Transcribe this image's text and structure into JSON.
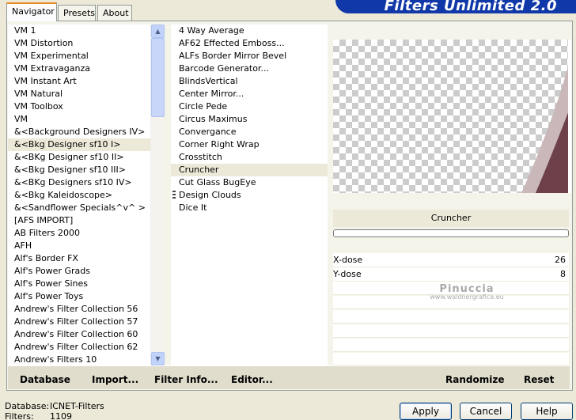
{
  "banner": {
    "title": "Filters Unlimited 2.0"
  },
  "tabs": [
    {
      "label": "Navigator",
      "active": true
    },
    {
      "label": "Presets"
    },
    {
      "label": "About"
    }
  ],
  "categories": [
    "VM 1",
    "VM Distortion",
    "VM Experimental",
    "VM Extravaganza",
    "VM Instant Art",
    "VM Natural",
    "VM Toolbox",
    "VM",
    "&<Background Designers IV>",
    "&<Bkg Designer sf10 I>",
    "&<BKg Designer sf10 II>",
    "&<Bkg Designer sf10 III>",
    "&<BKg Designers sf10 IV>",
    "&<Bkg Kaleidoscope>",
    "&<Sandflower Specials^v^ >",
    "[AFS IMPORT]",
    "AB Filters 2000",
    "AFH",
    "Alf's Border FX",
    "Alf's Power Grads",
    "Alf's Power Sines",
    "Alf's Power Toys",
    "Andrew's Filter Collection 56",
    "Andrew's Filter Collection 57",
    "Andrew's Filter Collection 60",
    "Andrew's Filter Collection 62",
    "Andrew's Filters 10"
  ],
  "selected_category_index": 9,
  "filters": [
    "4 Way Average",
    "AF62 Effected Emboss...",
    "ALFs Border Mirror Bevel",
    "Barcode Generator...",
    "BlindsVertical",
    "Center Mirror...",
    "Circle Pede",
    "Circus Maximus",
    "Convergance",
    "Corner Right Wrap",
    "Crosstitch",
    "Cruncher",
    "Cut Glass  BugEye",
    "Design Clouds",
    "Dice It"
  ],
  "selected_filter_index": 11,
  "preview": {
    "filter_name": "Cruncher",
    "accent_color": "#6e4049",
    "light_accent": "#c9b7b9"
  },
  "sliders": [
    {
      "label": "X-dose",
      "value": "26"
    },
    {
      "label": "Y-dose",
      "value": "8"
    }
  ],
  "watermark": {
    "name": "Pinuccia",
    "url": "www.waldnergrafica.eu"
  },
  "action_bar": {
    "database": "Database",
    "import": "Import...",
    "filter_info": "Filter Info...",
    "editor": "Editor...",
    "randomize": "Randomize",
    "reset": "Reset"
  },
  "info": {
    "database_label": "Database:",
    "database_value": "ICNET-Filters",
    "filters_label": "Filters:",
    "filters_value": "1109"
  },
  "buttons": {
    "apply": "Apply",
    "cancel": "Cancel",
    "help": "Help"
  }
}
